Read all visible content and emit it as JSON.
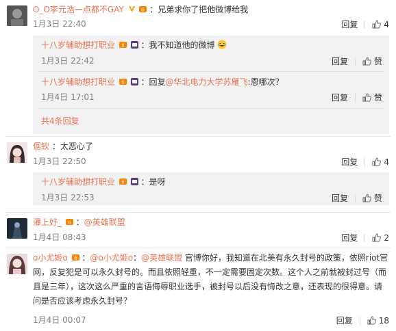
{
  "comments": [
    {
      "name": "O_O李元浩一点都不GAY",
      "text": "：兄弟求你了把他微博给我",
      "time": "1月3日 22:40",
      "reply_label": "回复",
      "likes": "4",
      "sub_replies": [
        {
          "name": "十八岁辅助想打职业",
          "text": "：我不知道他的微博",
          "time": "1月3日 22:42",
          "reply_label": "回复",
          "like_label": "赞"
        },
        {
          "name": "十八岁辅助想打职业",
          "text_prefix": "：回复",
          "mention": "@华北电力大学苏雁飞",
          "text": ":恩哪次？",
          "time": "1月4日 17:01",
          "reply_label": "回复",
          "like_label": "赞"
        }
      ],
      "more_label": "共4条回复"
    },
    {
      "name": "倨钦",
      "text": "：太恶心了",
      "time": "1月3日 22:50",
      "reply_label": "回复",
      "likes": "4",
      "sub_replies": [
        {
          "name": "十八岁辅助想打职业",
          "text": "：是呀",
          "time": "1月3日 22:53",
          "reply_label": "回复",
          "like_label": "赞"
        }
      ]
    },
    {
      "name": "瀑上好_",
      "text_prefix": "：",
      "mention": "@英雄联盟",
      "time": "1月4日 08:43",
      "reply_label": "回复",
      "likes": "2"
    },
    {
      "name": "o小尤姬o",
      "text_prefix": "：",
      "mention": "@o小尤姬o",
      "text_mid": "：",
      "mention2": "@英雄联盟",
      "line1": " 官博你好，我知道在北美有永久封号的政策，依照riot官",
      "line2": "网，反复犯是可以永久封号的。而且依照轻重，不一定需要固定次数。这个人之前就被封过号（而",
      "line3": "且是三年），这次这么严重的言语侮辱职业选手，被封号以后没有悔改之意，还表现的很得意。请",
      "line4": "问是否应该考虑永久封号？",
      "time": "1月4日 00:07",
      "reply_label": "回复",
      "likes": "18"
    }
  ],
  "colors": {
    "link": "#eb7350",
    "sub_bg": "#f2f2f2"
  }
}
